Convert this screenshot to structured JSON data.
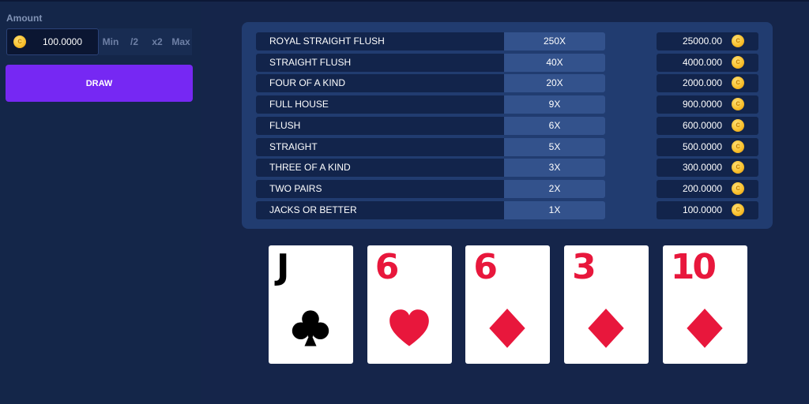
{
  "bet": {
    "amount_label": "Amount",
    "amount_value": "100.0000",
    "buttons": [
      "Min",
      "/2",
      "x2",
      "Max"
    ],
    "draw_label": "DRAW"
  },
  "paytable": [
    {
      "hand": "ROYAL STRAIGHT FLUSH",
      "multiplier": "250X",
      "win": "25000.00"
    },
    {
      "hand": "STRAIGHT FLUSH",
      "multiplier": "40X",
      "win": "4000.000"
    },
    {
      "hand": "FOUR OF A KIND",
      "multiplier": "20X",
      "win": "2000.000"
    },
    {
      "hand": "FULL HOUSE",
      "multiplier": "9X",
      "win": "900.0000"
    },
    {
      "hand": "FLUSH",
      "multiplier": "6X",
      "win": "600.0000"
    },
    {
      "hand": "STRAIGHT",
      "multiplier": "5X",
      "win": "500.0000"
    },
    {
      "hand": "THREE OF A KIND",
      "multiplier": "3X",
      "win": "300.0000"
    },
    {
      "hand": "TWO PAIRS",
      "multiplier": "2X",
      "win": "200.0000"
    },
    {
      "hand": "JACKS OR BETTER",
      "multiplier": "1X",
      "win": "100.0000"
    }
  ],
  "cards": [
    {
      "rank": "J",
      "suit": "clubs",
      "color": "black"
    },
    {
      "rank": "6",
      "suit": "hearts",
      "color": "red"
    },
    {
      "rank": "6",
      "suit": "diamonds",
      "color": "red"
    },
    {
      "rank": "3",
      "suit": "diamonds",
      "color": "red"
    },
    {
      "rank": "10",
      "suit": "diamonds",
      "color": "red"
    }
  ],
  "colors": {
    "background": "#15254a",
    "panel": "#213c70",
    "accent": "#7628f3",
    "card_red": "#e8173c"
  },
  "icons": {
    "currency": "coin-icon"
  }
}
